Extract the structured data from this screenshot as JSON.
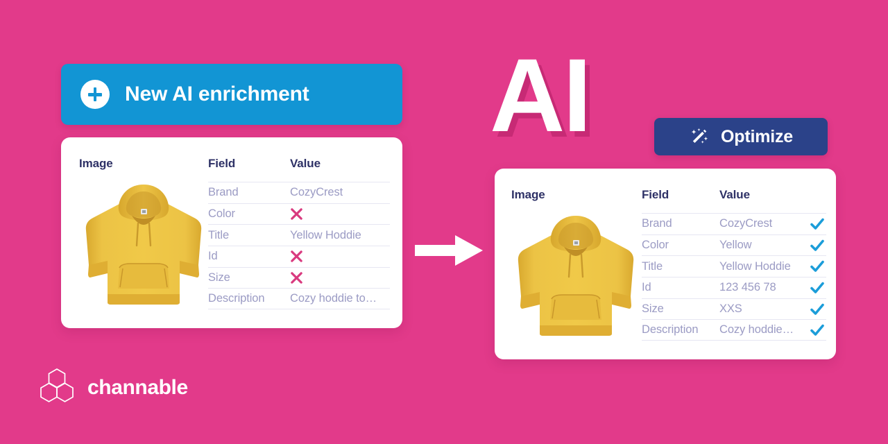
{
  "theme": {
    "background": "#e23a8a",
    "banner_blue": "#1295d4",
    "button_navy": "#2b4289",
    "heading_navy": "#2e3166",
    "body_text": "#9b9bc4",
    "check_blue": "#1b9dd9",
    "cross_pink": "#d93a7f",
    "hoodie_yellow": "#e8be3c",
    "card_white": "#ffffff",
    "rule_line": "#e6e6f2"
  },
  "banner": {
    "icon": "plus-circle-icon",
    "label": "New AI enrichment"
  },
  "ai_mark": {
    "text": "AI"
  },
  "optimize_button": {
    "icon": "magic-wand-icon",
    "label": "Optimize"
  },
  "arrow": {
    "icon": "arrow-right-icon"
  },
  "before_card": {
    "image_header": "Image",
    "product_image": "yellow-hoodie-image",
    "columns": {
      "field": "Field",
      "value": "Value"
    },
    "rows": [
      {
        "field": "Brand",
        "value": "CozyCrest",
        "status": "none"
      },
      {
        "field": "Color",
        "value": "",
        "status": "missing"
      },
      {
        "field": "Title",
        "value": "Yellow Hoddie",
        "status": "none"
      },
      {
        "field": "Id",
        "value": "",
        "status": "missing"
      },
      {
        "field": "Size",
        "value": "",
        "status": "missing"
      },
      {
        "field": "Description",
        "value": "Cozy hoddie to…",
        "status": "none"
      }
    ]
  },
  "after_card": {
    "image_header": "Image",
    "product_image": "yellow-hoodie-image",
    "columns": {
      "field": "Field",
      "value": "Value"
    },
    "rows": [
      {
        "field": "Brand",
        "value": "CozyCrest",
        "status": "ok"
      },
      {
        "field": "Color",
        "value": "Yellow",
        "status": "ok"
      },
      {
        "field": "Title",
        "value": "Yellow Hoddie",
        "status": "ok"
      },
      {
        "field": "Id",
        "value": "123 456 78",
        "status": "ok"
      },
      {
        "field": "Size",
        "value": "XXS",
        "status": "ok"
      },
      {
        "field": "Description",
        "value": "Cozy hoddie…",
        "status": "ok"
      }
    ]
  },
  "logo": {
    "mark": "channable-hexagon-logo",
    "text": "channable"
  }
}
